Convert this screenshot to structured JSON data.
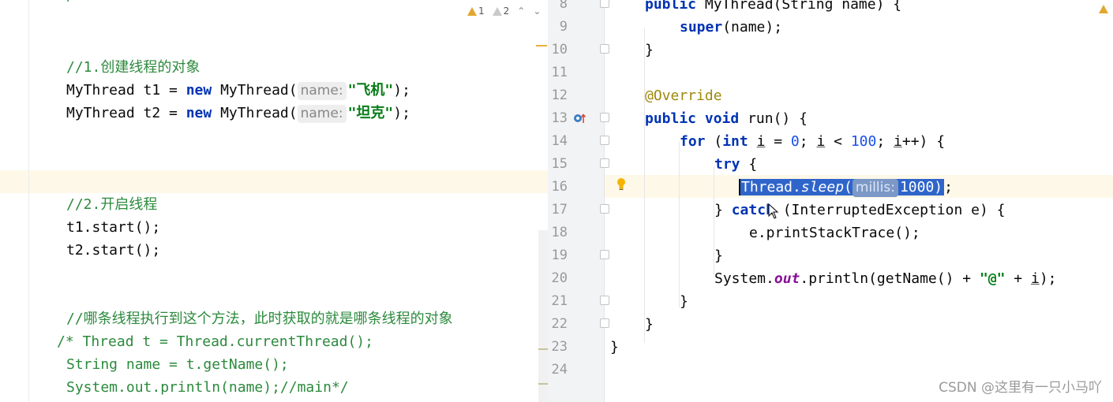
{
  "left": {
    "warnings": {
      "count_warn": "1",
      "count_weak": "2"
    },
    "top_fragment": "/",
    "lines": {
      "c1": "//1.创建线程的对象",
      "t1_decl_type": "MyThread t1 = ",
      "t1_new": "new",
      "t1_ctor": " MyThread(",
      "t1_hint": "name:",
      "t1_arg": "\"飞机\"",
      "t1_end": ");",
      "t2_decl_type": "MyThread t2 = ",
      "t2_new": "new",
      "t2_ctor": " MyThread(",
      "t2_hint": "name:",
      "t2_arg": "\"坦克\"",
      "t2_end": ");",
      "c2": "//2.开启线程",
      "start1": "t1.start();",
      "start2": "t2.start();",
      "c3": "//哪条线程执行到这个方法，此时获取的就是哪条线程的对象",
      "c4": "/* Thread t = Thread.currentThread();",
      "c5": "String name = t.getName();",
      "c6": "System.out.println(name);//main*/"
    }
  },
  "right": {
    "line_numbers": [
      "8",
      "9",
      "10",
      "11",
      "12",
      "13",
      "14",
      "15",
      "16",
      "17",
      "18",
      "19",
      "20",
      "21",
      "22",
      "23",
      "24"
    ],
    "code": {
      "l8_kw": "public",
      "l8_rest": " MyThread(String name) {",
      "l9_kw": "super",
      "l9_rest": "(name);",
      "l10": "}",
      "l12": "@Override",
      "l13_kw1": "public",
      "l13_kw2": "void",
      "l13_rest": " run() {",
      "l14_kw1": "for",
      "l14_p1": " (",
      "l14_kw2": "int",
      "l14_i1": "i",
      "l14_p2": " = ",
      "l14_n1": "0",
      "l14_p3": "; ",
      "l14_i2": "i",
      "l14_p4": " < ",
      "l14_n2": "100",
      "l14_p5": "; ",
      "l14_i3": "i",
      "l14_p6": "++) {",
      "l15_kw": "try",
      "l15_rest": " {",
      "l16_cls": "Thread.",
      "l16_method": "sleep",
      "l16_paren": "(",
      "l16_hint": "millis:",
      "l16_arg": "1000",
      "l16_close": ")",
      "l16_end": ";",
      "l17_brace": "} ",
      "l17_kw": "catch",
      "l17_rest": " (InterruptedException e) {",
      "l18": "e.printStackTrace();",
      "l19": "}",
      "l20_cls": "System.",
      "l20_field": "out",
      "l20_mid": ".println(getName() + ",
      "l20_str": "\"@\"",
      "l20_plus": " + ",
      "l20_i": "i",
      "l20_end": ");",
      "l21": "}",
      "l22": "}",
      "l23": "}"
    }
  },
  "watermark": "CSDN @这里有一只小马吖",
  "colors": {
    "keyword": "#0033b3",
    "string": "#067d17",
    "comment": "#2c8a3d",
    "number": "#1750eb",
    "annotation": "#9e880d",
    "selection": "#2f65ca",
    "current_line": "#fdf8e8"
  }
}
